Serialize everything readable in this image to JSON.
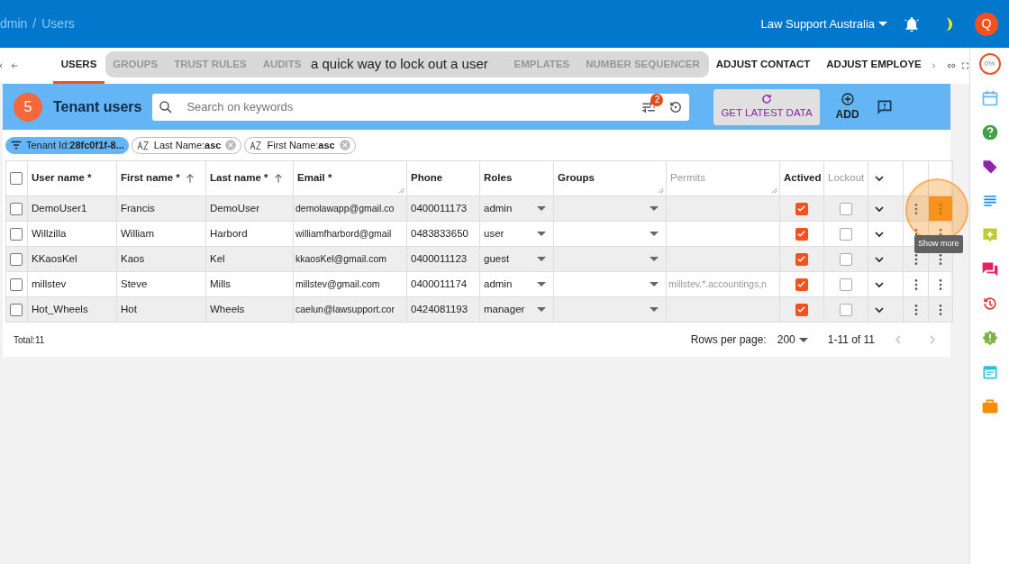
{
  "topbar": {
    "breadcrumb": {
      "items": [
        "dmin",
        "Users"
      ],
      "separator": "/"
    },
    "org": "Law Support Australia",
    "avatar": "Q"
  },
  "tabs": [
    {
      "label": "USERS",
      "selected": true
    },
    {
      "label": "GROUPS",
      "selected": false
    },
    {
      "label": "TRUST RULES",
      "selected": false
    },
    {
      "label": "AUDITS",
      "selected": false
    },
    {
      "label": "EMPLATES",
      "selected": false
    },
    {
      "label": "NUMBER SEQUENCER",
      "selected": false
    },
    {
      "label": "ADJUST CONTACT",
      "selected": false
    },
    {
      "label": "ADJUST EMPLOYE",
      "selected": false
    }
  ],
  "caption": "a quick way to lock out a user",
  "panel": {
    "step": "5",
    "title": "Tenant users",
    "search": {
      "placeholder": "Search on keywords"
    },
    "filter_count": "2",
    "refresh_button": "GET LATEST DATA",
    "add_button": "ADD"
  },
  "chips": [
    {
      "kind": "filter",
      "text": "Tenant Id:**28fc0f1f-8...**"
    },
    {
      "kind": "sort",
      "text": "Last Name:**asc**"
    },
    {
      "kind": "sort",
      "text": "First Name:**asc**"
    }
  ],
  "table": {
    "all_checked": false,
    "columns": [
      {
        "label": "User name *",
        "sorted": false,
        "resizable": false,
        "disabled": false
      },
      {
        "label": "First name *",
        "sorted": true,
        "resizable": false,
        "disabled": false
      },
      {
        "label": "Last name *",
        "sorted": true,
        "resizable": false,
        "disabled": false
      },
      {
        "label": "Email *",
        "sorted": false,
        "resizable": true,
        "disabled": false
      },
      {
        "label": "Phone",
        "sorted": false,
        "resizable": false,
        "disabled": false
      },
      {
        "label": "Roles",
        "sorted": false,
        "resizable": false,
        "disabled": false
      },
      {
        "label": "Groups",
        "sorted": false,
        "resizable": true,
        "disabled": false
      },
      {
        "label": "Permits",
        "sorted": false,
        "resizable": true,
        "disabled": true
      },
      {
        "label": "Actived",
        "sorted": false,
        "resizable": false,
        "disabled": false
      },
      {
        "label": "Lockout",
        "sorted": false,
        "resizable": false,
        "disabled": true
      }
    ],
    "rows": [
      {
        "checked": false,
        "username": "DemoUser1",
        "first": "Francis",
        "last": "DemoUser",
        "email": "demolawapp@gmail.co",
        "phone": "0400011173",
        "role": "admin",
        "permits": "",
        "actived": true,
        "lockout": false,
        "menu_active": true
      },
      {
        "checked": false,
        "username": "Willzilla",
        "first": "William",
        "last": "Harbord",
        "email": "williamfharbord@gmail",
        "phone": "0483833650",
        "role": "user",
        "permits": "",
        "actived": true,
        "lockout": false,
        "menu_active": false
      },
      {
        "checked": false,
        "username": "KKaosKel",
        "first": "Kaos",
        "last": "Kel",
        "email": "kkaosKel@gmail.com",
        "phone": "0400011123",
        "role": "guest",
        "permits": "",
        "actived": true,
        "lockout": false,
        "menu_active": false
      },
      {
        "checked": false,
        "username": "millstev",
        "first": "Steve",
        "last": "Mills",
        "email": "millstev@gmail.com",
        "phone": "0400011174",
        "role": "admin",
        "permits": "millstev.*.accountings,n",
        "actived": true,
        "lockout": false,
        "menu_active": false
      },
      {
        "checked": false,
        "username": "Hot_Wheels",
        "first": "Hot",
        "last": "Wheels",
        "email": "caelun@lawsupport.cor",
        "phone": "0424081193",
        "role": "manager",
        "permits": "",
        "actived": true,
        "lockout": false,
        "menu_active": false
      }
    ]
  },
  "tooltip": "Show more",
  "footer": {
    "total": "Total:11",
    "rows_per_page_label": "Rows per page:",
    "rows_per_page": "200",
    "range": "1-11 of 11"
  },
  "sidebar": {
    "progress": "0%"
  }
}
